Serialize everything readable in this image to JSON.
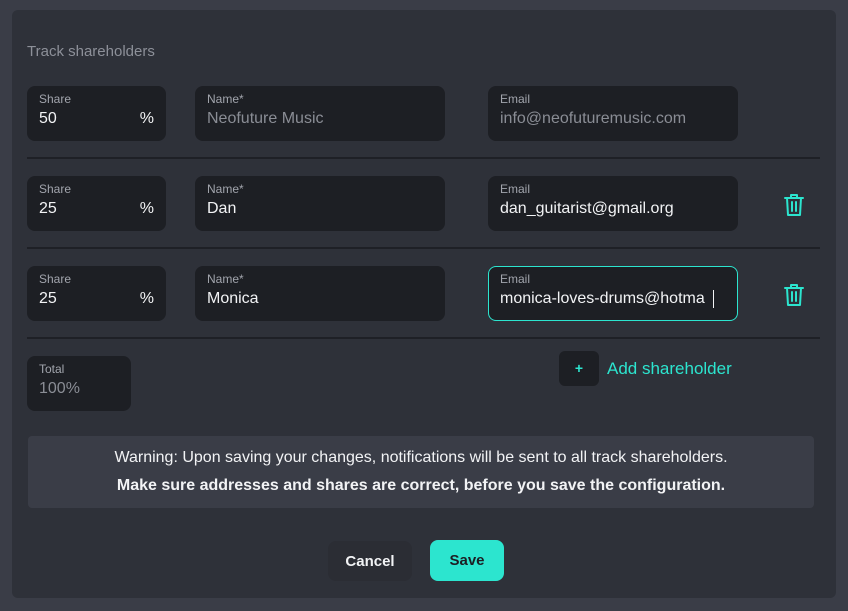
{
  "section_title": "Track shareholders",
  "labels": {
    "share": "Share",
    "name": "Name*",
    "email": "Email",
    "percent": "%"
  },
  "shareholders": [
    {
      "share": "50",
      "name": "Neofuture Music",
      "email": "info@neofuturemusic.com",
      "locked": true
    },
    {
      "share": "25",
      "name": "Dan",
      "email": "dan_guitarist@gmail.org",
      "locked": false
    },
    {
      "share": "25",
      "name": "Monica",
      "email": "monica-loves-drums@hotma",
      "locked": false,
      "focused_field": "email"
    }
  ],
  "total": {
    "label": "Total",
    "value": "100%"
  },
  "add_button": {
    "icon": "+",
    "label": "Add shareholder"
  },
  "warning": {
    "line1": "Warning: Upon saving your changes, notifications will be sent to all track shareholders.",
    "line2": "Make sure addresses and shares are correct, before you save the configuration."
  },
  "actions": {
    "cancel": "Cancel",
    "save": "Save"
  },
  "colors": {
    "accent": "#2ce5cf",
    "panel": "#2e3139",
    "field": "#1d1f24",
    "background": "#3a3d47"
  },
  "icons": {
    "delete": "trash-icon",
    "add": "plus-icon"
  }
}
